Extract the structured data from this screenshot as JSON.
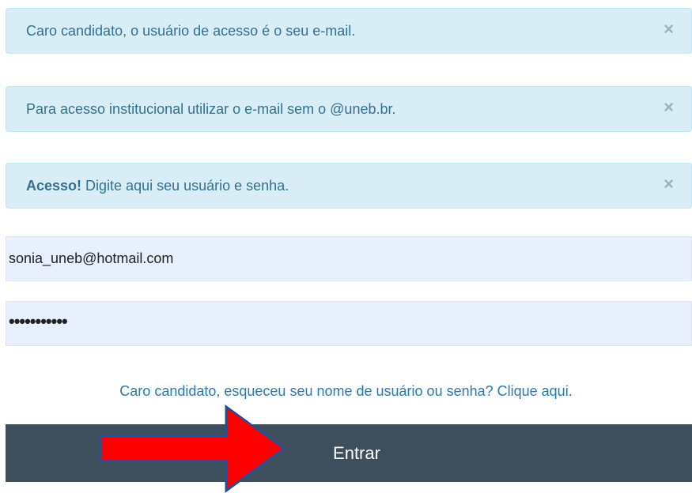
{
  "alerts": [
    {
      "text": "Caro candidato, o usuário de acesso é o seu e-mail.",
      "close": "×"
    },
    {
      "text": "Para acesso institucional utilizar o e-mail sem o @uneb.br.",
      "close": "×"
    },
    {
      "strong": "Acesso!",
      "text": " Digite aqui seu usuário e senha.",
      "close": "×"
    }
  ],
  "login": {
    "username_value": "sonia_uneb@hotmail.com",
    "password_mask": "•••••••••••",
    "forgot_link": "Caro candidato, esqueceu seu nome de usuário ou senha? Clique aqui.",
    "submit_label": "Entrar"
  },
  "colors": {
    "alert_bg": "#d9edf7",
    "alert_text": "#31708f",
    "button_bg": "#3d4f5c",
    "link": "#2a7ab0",
    "input_bg": "#e8f0fe",
    "annotation_arrow": "#ff0000"
  },
  "annotation": {
    "icon": "red-right-arrow-icon"
  }
}
